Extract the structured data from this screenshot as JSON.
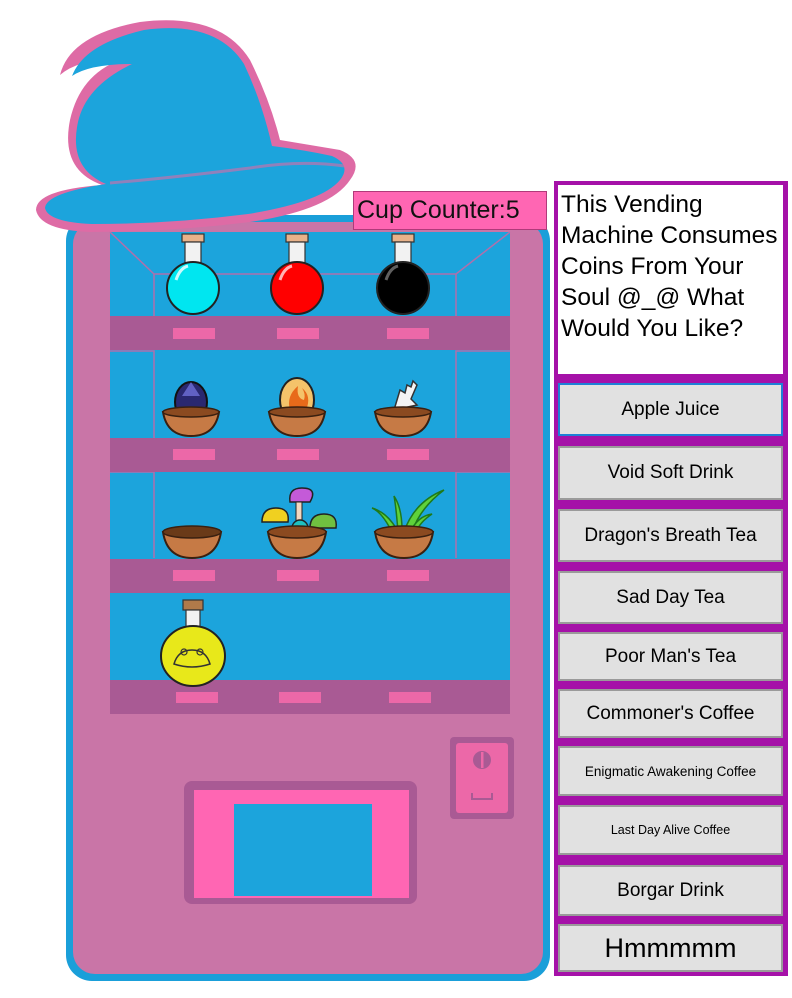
{
  "cup_counter": {
    "label": "Cup Counter:",
    "value": "5"
  },
  "message": "This Vending Machine Consumes Coins From Your Soul @_@ What Would You Like?",
  "menu": [
    "Apple Juice",
    "Void Soft Drink",
    "Dragon's Breath Tea",
    "Sad Day Tea",
    "Poor Man's Tea",
    "Commoner's Coffee",
    "Enigmatic Awakening Coffee",
    "Last Day Alive Coffee",
    "Borgar Drink",
    "Hmmmmm"
  ],
  "colors": {
    "machine_body": "#c975a7",
    "machine_outline": "#1a9fd9",
    "shelf_glass": "#1ca4dc",
    "shelf_tray": "#a95a94",
    "slot": "#ec68a8",
    "hat": "#1ca4dc",
    "hat_outline": "#de6ba5",
    "panel_border": "#a511a8",
    "button_bg": "#e1e1e1",
    "button_focus_border": "#1e80d6"
  },
  "items": {
    "shelf1": [
      "cyan-potion-icon",
      "red-potion-icon",
      "black-potion-icon"
    ],
    "shelf2": [
      "dark-crystal-egg-icon",
      "fire-egg-icon",
      "skeleton-hand-bowl-icon"
    ],
    "shelf3": [
      "empty-bowl-icon",
      "mushroom-bowl-icon",
      "grass-bowl-icon"
    ],
    "shelf4": [
      "frog-potion-icon"
    ]
  }
}
